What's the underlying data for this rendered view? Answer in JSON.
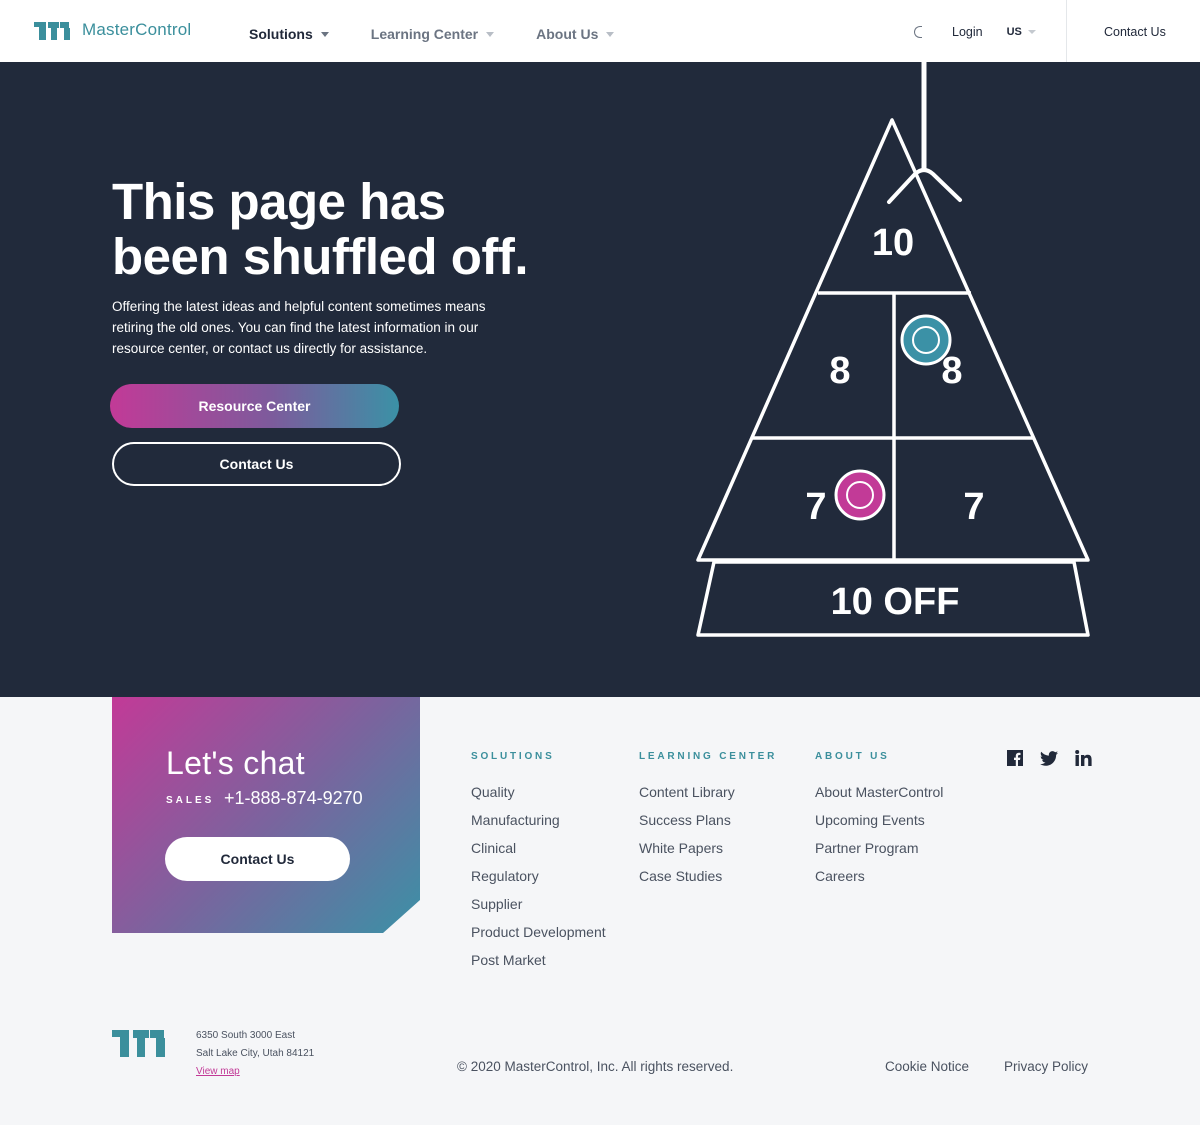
{
  "header": {
    "brand": "MasterControl",
    "nav": [
      "Solutions",
      "Learning Center",
      "About Us"
    ],
    "login": "Login",
    "locale": "US",
    "contact": "Contact Us"
  },
  "hero": {
    "title": "This page has been shuffled off.",
    "body": "Offering the latest ideas and helpful content sometimes means retiring the old ones. You can find the latest information in our resource center, or contact us directly for assistance.",
    "primary_button": "Resource Center",
    "secondary_button": "Contact Us",
    "board": {
      "top": "10",
      "left_middle": "8",
      "right_middle": "8",
      "left_lower": "7",
      "right_lower": "7",
      "bottom": "10 OFF",
      "puck_colors": [
        "#3b91a6",
        "#c23a97"
      ]
    }
  },
  "chat": {
    "title": "Let's chat",
    "sales_label": "SALES",
    "phone": "+1-888-874-9270",
    "button": "Contact Us"
  },
  "footer": {
    "solutions": {
      "heading": "SOLUTIONS",
      "links": [
        "Quality",
        "Manufacturing",
        "Clinical",
        "Regulatory",
        "Supplier",
        "Product Development",
        "Post Market"
      ]
    },
    "learning": {
      "heading": "LEARNING CENTER",
      "links": [
        "Content Library",
        "Success Plans",
        "White Papers",
        "Case Studies"
      ]
    },
    "about": {
      "heading": "ABOUT US",
      "links": [
        "About MasterControl",
        "Upcoming Events",
        "Partner Program",
        "Careers"
      ]
    },
    "social": [
      "facebook-icon",
      "twitter-icon",
      "linkedin-icon"
    ],
    "address_line1": "6350 South 3000 East",
    "address_line2": "Salt Lake City, Utah 84121",
    "view_map": "View map",
    "copyright": "© 2020 MasterControl, Inc. All rights reserved.",
    "cookie": "Cookie Notice",
    "privacy": "Privacy Policy"
  },
  "colors": {
    "brand_teal": "#3b8f9c",
    "brand_magenta": "#c23a97",
    "hero_bg": "#212a3b"
  }
}
